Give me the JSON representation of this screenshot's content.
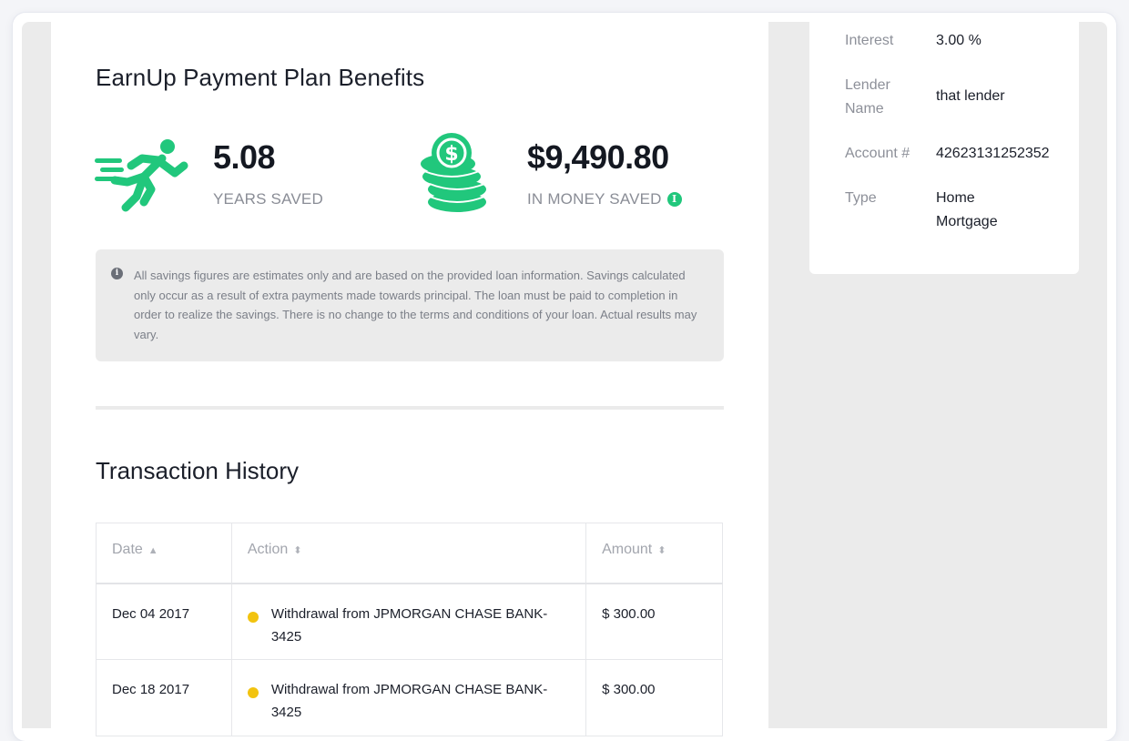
{
  "benefits": {
    "title": "EarnUp Payment Plan Benefits",
    "years_value": "5.08",
    "years_label": "YEARS SAVED",
    "money_value": "$9,490.80",
    "money_label": "IN MONEY SAVED",
    "info_glyph": "i",
    "notice": "All savings figures are estimates only and are based on the provided loan information. Savings calculated only occur as a result of extra payments made towards principal. The loan must be paid to completion in order to realize the savings. There is no change to the terms and conditions of your loan. Actual results may vary."
  },
  "transactions": {
    "title": "Transaction History",
    "columns": [
      "Date",
      "Action",
      "Amount"
    ],
    "rows": [
      {
        "date": "Dec 04 2017",
        "action": "Withdrawal from JPMORGAN CHASE BANK-3425",
        "amount": "$ 300.00"
      },
      {
        "date": "Dec 18 2017",
        "action": "Withdrawal from JPMORGAN CHASE BANK-3425",
        "amount": "$ 300.00"
      }
    ]
  },
  "loan_details": {
    "interest_label": "Interest",
    "interest_value": "3.00 %",
    "lender_label_1": "Lender",
    "lender_label_2": "Name",
    "lender_value": "that lender",
    "account_label": "Account #",
    "account_value": "42623131252352",
    "type_label": "Type",
    "type_value_1": "Home",
    "type_value_2": "Mortgage"
  },
  "colors": {
    "accent_green": "#21c77c",
    "pending_dot": "#f2c30f",
    "panel_gray": "#ebebeb"
  },
  "icons": {
    "years": "running-person-icon",
    "money": "coin-stack-icon",
    "info": "info-circle-icon",
    "sort_asc": "sort-up-icon",
    "sort_both": "sort-icon"
  }
}
